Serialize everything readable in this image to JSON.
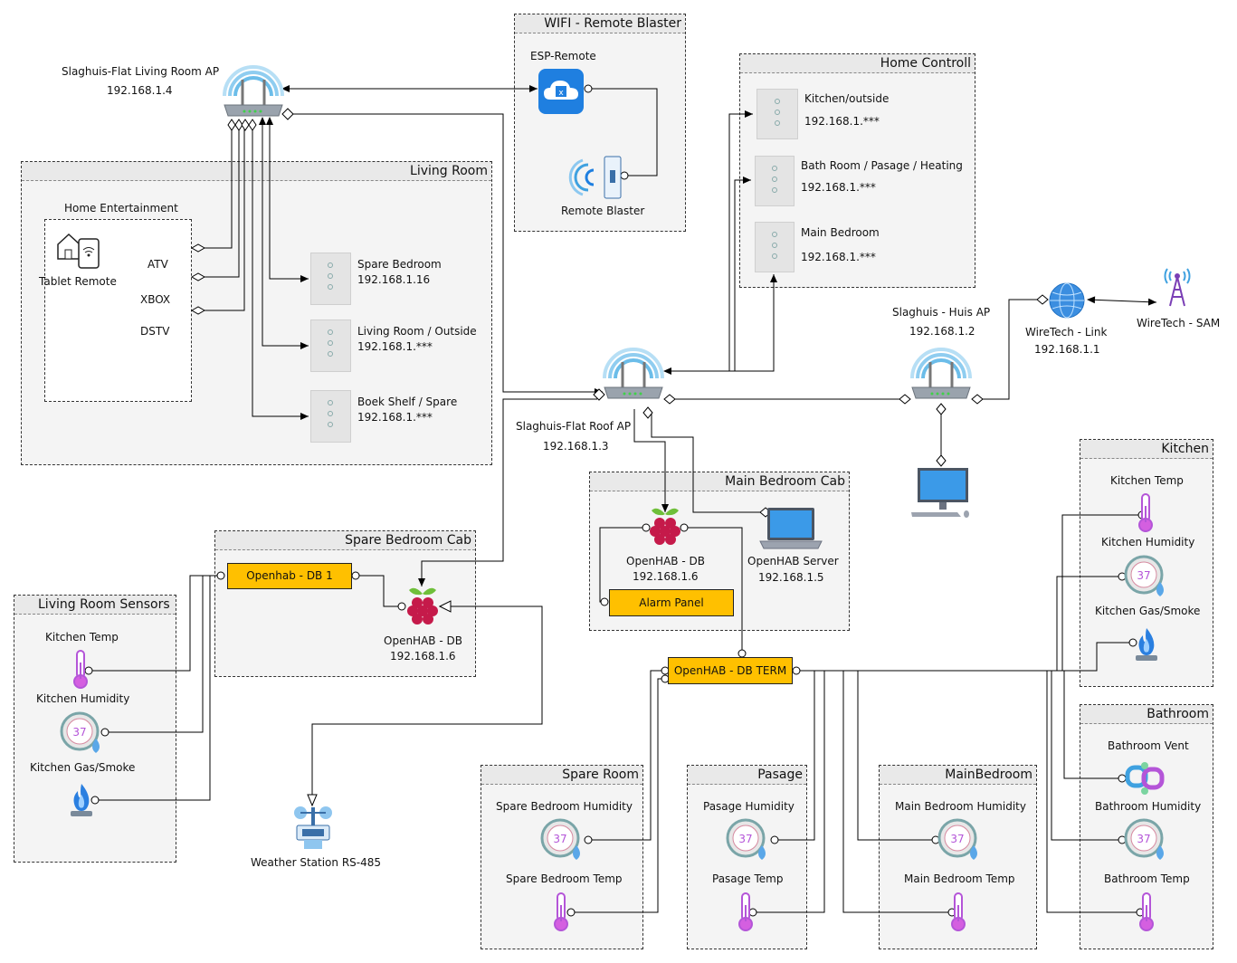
{
  "colors": {
    "accent_yellow": "#ffc000",
    "router_blue": "#2f8fd8",
    "thermo_purple": "#b455d8",
    "drop_blue": "#5aa7e8",
    "flame_blue": "#2a7fe0",
    "rpi_red": "#c51a4a"
  },
  "groups": {
    "wifi_remote": "WIFI - Remote Blaster",
    "home_control": "Home Controll",
    "living_room": "Living Room",
    "spare_bedroom_cab": "Spare Bedroom Cab",
    "main_bedroom_cab": "Main Bedroom Cab",
    "living_room_sensors": "Living Room Sensors",
    "kitchen": "Kitchen",
    "bathroom": "Bathroom",
    "spare_room": "Spare Room",
    "pasage": "Pasage",
    "main_bedroom": "MainBedroom"
  },
  "routers": {
    "living_ap": {
      "name": "Slaghuis-Flat Living Room AP",
      "ip": "192.168.1.4"
    },
    "roof_ap": {
      "name": "Slaghuis-Flat  Roof AP",
      "ip": "192.168.1.3"
    },
    "huis_ap": {
      "name": "Slaghuis - Huis AP",
      "ip": "192.168.1.2"
    }
  },
  "wirelink": {
    "name": "WireTech - Link",
    "ip": "192.168.1.1"
  },
  "wiresam": {
    "name": "WireTech - SAM"
  },
  "esp": {
    "label": "ESP-Remote"
  },
  "blaster": {
    "label": "Remote Blaster"
  },
  "home_control": {
    "items": [
      {
        "name": "Kitchen/outside",
        "ip": "192.168.1.***"
      },
      {
        "name": "Bath Room / Pasage / Heating",
        "ip": "192.168.1.***"
      },
      {
        "name": "Main Bedroom",
        "ip": "192.168.1.***"
      }
    ]
  },
  "living_room": {
    "entertainment": "Home Entertainment",
    "tablet": "Tablet Remote",
    "atv": "ATV",
    "xbox": "XBOX",
    "dstv": "DSTV",
    "switches": [
      {
        "name": "Spare Bedroom",
        "ip": "192.168.1.16"
      },
      {
        "name": "Living Room / Outside",
        "ip": "192.168.1.***"
      },
      {
        "name": "Boek Shelf / Spare",
        "ip": "192.168.1.***"
      }
    ]
  },
  "spare_cab": {
    "db1": "Openhab - DB 1",
    "rpi_name": "OpenHAB - DB",
    "rpi_ip": "192.168.1.6"
  },
  "main_cab": {
    "rpi_name": "OpenHAB - DB",
    "rpi_ip": "192.168.1.6",
    "server_name": "OpenHAB Server",
    "server_ip": "192.168.1.5",
    "alarm": "Alarm Panel"
  },
  "term": "OpenHAB - DB TERM",
  "weather": "Weather Station RS-485",
  "lr_sensors": {
    "temp": "Kitchen Temp",
    "humidity": "Kitchen Humidity",
    "gas": "Kitchen Gas/Smoke"
  },
  "kitchen": {
    "temp": "Kitchen Temp",
    "humidity": "Kitchen Humidity",
    "gas": "Kitchen Gas/Smoke"
  },
  "bathroom": {
    "vent": "Bathroom Vent",
    "humidity": "Bathroom Humidity",
    "temp": "Bathroom Temp"
  },
  "spare_room": {
    "humidity": "Spare Bedroom Humidity",
    "temp": "Spare Bedroom Temp"
  },
  "pasage": {
    "humidity": "Pasage Humidity",
    "temp": "Pasage Temp"
  },
  "mainbed": {
    "humidity": "Main Bedroom Humidity",
    "temp": "Main Bedroom Temp"
  }
}
